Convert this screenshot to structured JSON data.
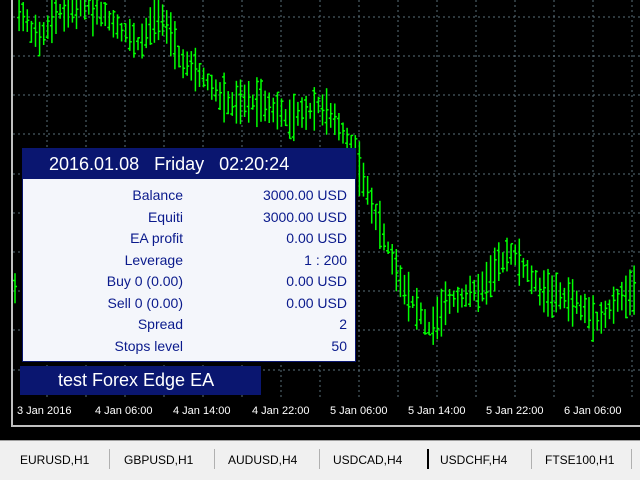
{
  "chart": {
    "background": "#000000",
    "candle_color": "#00ff00",
    "grid_color": "#5a6f7a",
    "time_labels": [
      "3 Jan 2016",
      "4 Jan 06:00",
      "4 Jan 14:00",
      "4 Jan 22:00",
      "5 Jan 06:00",
      "5 Jan 14:00",
      "5 Jan 22:00",
      "6 Jan 06:00"
    ]
  },
  "info_panel": {
    "date": "2016.01.08",
    "day": "Friday",
    "time": "02:20:24",
    "rows": [
      {
        "label": "Balance",
        "value": "3000.00  USD"
      },
      {
        "label": "Equiti",
        "value": "3000.00  USD"
      },
      {
        "label": "EA profit",
        "value": "0.00  USD"
      },
      {
        "label": "Leverage",
        "value": "1 : 200"
      },
      {
        "label": "Buy 0 (0.00)",
        "value": "0.00  USD"
      },
      {
        "label": "Sell 0 (0.00)",
        "value": "0.00  USD"
      },
      {
        "label": "Spread",
        "value": "2"
      },
      {
        "label": "Stops level",
        "value": "50"
      }
    ]
  },
  "ea_name": "test Forex Edge EA",
  "tabs": [
    "EURUSD,H1",
    "GBPUSD,H1",
    "AUDUSD,H4",
    "USDCAD,H4",
    "USDCHF,H4",
    "FTSE100,H1"
  ]
}
